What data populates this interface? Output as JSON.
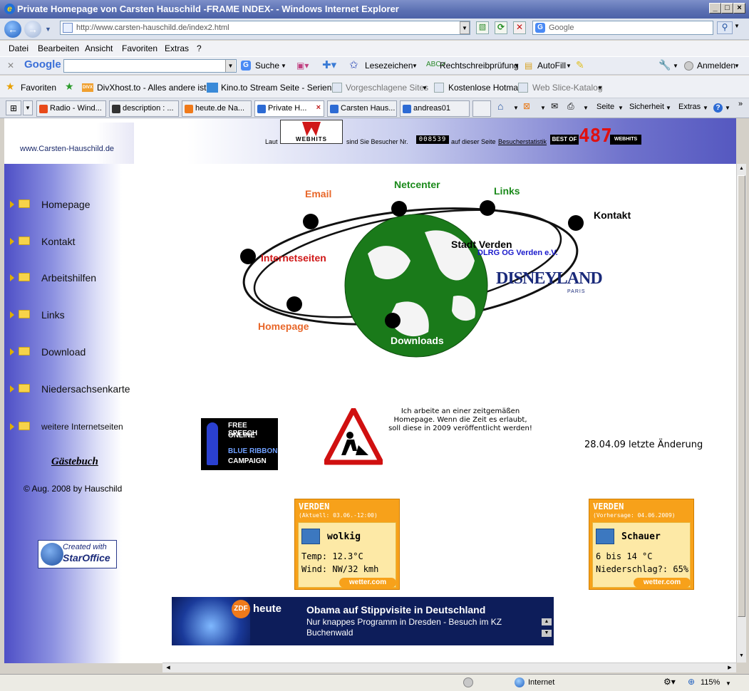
{
  "window": {
    "title": "Private Homepage von Carsten Hauschild -FRAME INDEX- - Windows Internet Explorer",
    "url": "http://www.carsten-hauschild.de/index2.html",
    "search_placeholder": "Google"
  },
  "menu": [
    "Datei",
    "Bearbeiten",
    "Ansicht",
    "Favoriten",
    "Extras",
    "?"
  ],
  "google_toolbar": {
    "suche": "Suche",
    "lesezeichen": "Lesezeichen",
    "rechtschreib": "Rechtschreibprüfung",
    "autofill": "AutoFill",
    "anmelden": "Anmelden"
  },
  "favorites_bar": {
    "favoriten": "Favoriten",
    "items": [
      "DivXhost.to - Alles andere ist ...",
      "Kino.to Stream Seite - Serien ...",
      "Vorgeschlagene Sites",
      "Kostenlose Hotmail",
      "Web Slice-Katalog"
    ]
  },
  "tabs": [
    "Radio - Wind...",
    "description : ...",
    "heute.de Na...",
    "Private H...",
    "Carsten Haus...",
    "andreas01"
  ],
  "command_bar": {
    "seite": "Seite",
    "sicherheit": "Sicherheit",
    "extras": "Extras"
  },
  "statusbar": {
    "zone": "Internet",
    "zoom": "115%"
  },
  "header": {
    "logo_text": "www.Carsten-Hauschild.de",
    "laut": "Laut",
    "webhits": "WEBHITS",
    "visitor_text_1": "sind Sie Besucher Nr.",
    "counter": "008539",
    "visitor_text_2": "auf dieser Seite",
    "stats_link": "Besucherstatistik",
    "best_of": "BEST OF",
    "best_num": "487",
    "best_webhits": "WEBHITS"
  },
  "nav": {
    "items": [
      "Homepage",
      "Kontakt",
      "Arbeitshilfen",
      "Links",
      "Download",
      "Niedersachsenkarte",
      "weitere Internetseiten"
    ],
    "guestbook": "Gästebuch",
    "copyright": "© Aug. 2008 by Hauschild",
    "created_with": "Created with",
    "staroffice": "StarOffice"
  },
  "orbit": {
    "email": "Email",
    "netcenter": "Netcenter",
    "links": "Links",
    "kontakt": "Kontakt",
    "internetseiten": "Internetseiten",
    "homepage": "Homepage",
    "downloads": "Downloads",
    "stadt_verden": "Stadt Verden",
    "dlrg": "DLRG OG Verden e.V.",
    "disneyland": "DISNEYLAND",
    "paris": "PARIS"
  },
  "free_speech": {
    "line1": "FREE SPEECH",
    "line2": "ONLINE",
    "line3": "BLUE RIBBON",
    "line4": "CAMPAIGN"
  },
  "construction_text": "Ich arbeite an einer zeitgemäßen Homepage. Wenn die Zeit es erlaubt, soll diese in 2009 veröffentlicht werden!",
  "last_change": "28.04.09 letzte Änderung",
  "weather": [
    {
      "city": "VERDEN",
      "sub": "(Aktuell: 03.06.-12:00)",
      "condition": "wolkig",
      "line1": "Temp: 12.3°C",
      "line2": "Wind: NW/32 kmh",
      "brand": "wetter.com"
    },
    {
      "city": "VERDEN",
      "sub": "(Vorhersage: 04.06.2009)",
      "condition": "Schauer",
      "line1": "6 bis 14 °C",
      "line2": "Niederschlag?: 65%",
      "brand": "wetter.com"
    }
  ],
  "news": {
    "brand": "heute",
    "zdf": "ZDF",
    "headline": "Obama auf Stippvisite in Deutschland",
    "text": "Nur knappes Programm in Dresden - Besuch im KZ Buchenwald"
  },
  "colors": {
    "email": "#e8672a",
    "netcenter": "#1b8a1b",
    "links": "#1b8a1b",
    "kontakt": "#000000",
    "internetseiten": "#d01818",
    "homepage": "#e8672a",
    "dlrg": "#1a1acc",
    "disney": "#1a2a7a"
  }
}
